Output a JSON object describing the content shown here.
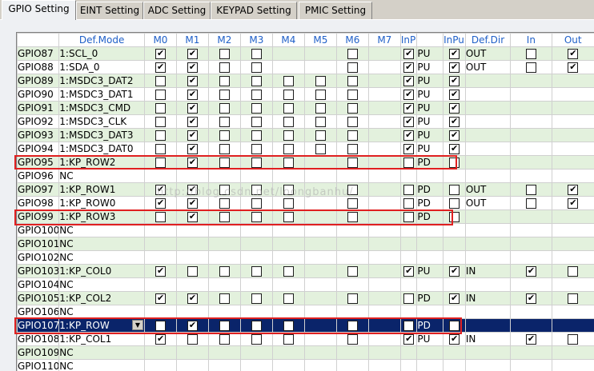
{
  "tabs": [
    {
      "label": "GPIO Setting",
      "active": true
    },
    {
      "label": "EINT Setting",
      "active": false
    },
    {
      "label": "ADC Setting",
      "active": false
    },
    {
      "label": "KEYPAD Setting",
      "active": false
    },
    {
      "label": "PMIC Setting",
      "active": false
    }
  ],
  "columns": [
    "",
    "Def.Mode",
    "M0",
    "M1",
    "M2",
    "M3",
    "M4",
    "M5",
    "M6",
    "M7",
    "InPu...",
    "",
    "InPu...",
    "Def.Dir",
    "In",
    "Out"
  ],
  "watermark": "http://blog.csdn.net/loongbanhu/",
  "rows": [
    {
      "gpio": "GPIO87",
      "mode": "1:SCL_0",
      "m": [
        1,
        1,
        0,
        0,
        null,
        null,
        0,
        null
      ],
      "pullSel": 1,
      "pull": "PU",
      "pullEn": 1,
      "dir": "OUT",
      "in": 0,
      "out": 1,
      "style": "even"
    },
    {
      "gpio": "GPIO88",
      "mode": "1:SDA_0",
      "m": [
        1,
        1,
        0,
        0,
        null,
        null,
        0,
        null
      ],
      "pullSel": 1,
      "pull": "PU",
      "pullEn": 1,
      "dir": "OUT",
      "in": 0,
      "out": 1,
      "style": "odd"
    },
    {
      "gpio": "GPIO89",
      "mode": "1:MSDC3_DAT2",
      "m": [
        0,
        1,
        0,
        0,
        0,
        0,
        0,
        null
      ],
      "pullSel": 1,
      "pull": "PU",
      "pullEn": 1,
      "dir": "",
      "in": null,
      "out": null,
      "style": "even"
    },
    {
      "gpio": "GPIO90",
      "mode": "1:MSDC3_DAT1",
      "m": [
        0,
        1,
        0,
        0,
        0,
        0,
        0,
        null
      ],
      "pullSel": 1,
      "pull": "PU",
      "pullEn": 1,
      "dir": "",
      "in": null,
      "out": null,
      "style": "odd"
    },
    {
      "gpio": "GPIO91",
      "mode": "1:MSDC3_CMD",
      "m": [
        0,
        1,
        0,
        0,
        0,
        0,
        0,
        null
      ],
      "pullSel": 1,
      "pull": "PU",
      "pullEn": 1,
      "dir": "",
      "in": null,
      "out": null,
      "style": "even"
    },
    {
      "gpio": "GPIO92",
      "mode": "1:MSDC3_CLK",
      "m": [
        0,
        1,
        0,
        0,
        0,
        0,
        0,
        null
      ],
      "pullSel": 1,
      "pull": "PU",
      "pullEn": 1,
      "dir": "",
      "in": null,
      "out": null,
      "style": "odd"
    },
    {
      "gpio": "GPIO93",
      "mode": "1:MSDC3_DAT3",
      "m": [
        0,
        1,
        0,
        0,
        0,
        0,
        0,
        null
      ],
      "pullSel": 1,
      "pull": "PU",
      "pullEn": 1,
      "dir": "",
      "in": null,
      "out": null,
      "style": "even"
    },
    {
      "gpio": "GPIO94",
      "mode": "1:MSDC3_DAT0",
      "m": [
        0,
        1,
        0,
        0,
        0,
        0,
        0,
        null
      ],
      "pullSel": 1,
      "pull": "PU",
      "pullEn": 1,
      "dir": "",
      "in": null,
      "out": null,
      "style": "odd"
    },
    {
      "gpio": "GPIO95",
      "mode": "1:KP_ROW2",
      "m": [
        0,
        1,
        0,
        0,
        0,
        null,
        0,
        null
      ],
      "pullSel": 0,
      "pull": "PD",
      "pullEn": 0,
      "dir": "",
      "in": null,
      "out": null,
      "style": "even"
    },
    {
      "gpio": "GPIO96",
      "mode": "NC",
      "m": [
        null,
        null,
        null,
        null,
        null,
        null,
        null,
        null
      ],
      "pullSel": null,
      "pull": "",
      "pullEn": null,
      "dir": "",
      "in": null,
      "out": null,
      "style": "odd"
    },
    {
      "gpio": "GPIO97",
      "mode": "1:KP_ROW1",
      "m": [
        1,
        1,
        0,
        0,
        0,
        null,
        0,
        null
      ],
      "pullSel": 0,
      "pull": "PD",
      "pullEn": 0,
      "dir": "OUT",
      "in": 0,
      "out": 1,
      "style": "even"
    },
    {
      "gpio": "GPIO98",
      "mode": "1:KP_ROW0",
      "m": [
        1,
        1,
        0,
        0,
        0,
        null,
        0,
        null
      ],
      "pullSel": 0,
      "pull": "PD",
      "pullEn": 0,
      "dir": "OUT",
      "in": 0,
      "out": 1,
      "style": "odd"
    },
    {
      "gpio": "GPIO99",
      "mode": "1:KP_ROW3",
      "m": [
        0,
        1,
        0,
        0,
        0,
        null,
        0,
        null
      ],
      "pullSel": 0,
      "pull": "PD",
      "pullEn": 0,
      "dir": "",
      "in": null,
      "out": null,
      "style": "even"
    },
    {
      "gpio": "GPIO100",
      "mode": "NC",
      "m": [
        null,
        null,
        null,
        null,
        null,
        null,
        null,
        null
      ],
      "pullSel": null,
      "pull": "",
      "pullEn": null,
      "dir": "",
      "in": null,
      "out": null,
      "style": "odd"
    },
    {
      "gpio": "GPIO101",
      "mode": "NC",
      "m": [
        null,
        null,
        null,
        null,
        null,
        null,
        null,
        null
      ],
      "pullSel": null,
      "pull": "",
      "pullEn": null,
      "dir": "",
      "in": null,
      "out": null,
      "style": "even"
    },
    {
      "gpio": "GPIO102",
      "mode": "NC",
      "m": [
        null,
        null,
        null,
        null,
        null,
        null,
        null,
        null
      ],
      "pullSel": null,
      "pull": "",
      "pullEn": null,
      "dir": "",
      "in": null,
      "out": null,
      "style": "odd"
    },
    {
      "gpio": "GPIO103",
      "mode": "1:KP_COL0",
      "m": [
        1,
        0,
        0,
        0,
        0,
        null,
        0,
        null
      ],
      "pullSel": 1,
      "pull": "PU",
      "pullEn": 1,
      "dir": "IN",
      "in": 1,
      "out": 0,
      "style": "even"
    },
    {
      "gpio": "GPIO104",
      "mode": "NC",
      "m": [
        null,
        null,
        null,
        null,
        null,
        null,
        null,
        null
      ],
      "pullSel": null,
      "pull": "",
      "pullEn": null,
      "dir": "",
      "in": null,
      "out": null,
      "style": "odd"
    },
    {
      "gpio": "GPIO105",
      "mode": "1:KP_COL2",
      "m": [
        1,
        1,
        0,
        0,
        0,
        null,
        0,
        null
      ],
      "pullSel": 0,
      "pull": "PD",
      "pullEn": 1,
      "dir": "IN",
      "in": 1,
      "out": 0,
      "style": "even"
    },
    {
      "gpio": "GPIO106",
      "mode": "NC",
      "m": [
        null,
        null,
        null,
        null,
        null,
        null,
        null,
        null
      ],
      "pullSel": null,
      "pull": "",
      "pullEn": null,
      "dir": "",
      "in": null,
      "out": null,
      "style": "odd"
    },
    {
      "gpio": "GPIO107",
      "mode": "1:KP_ROW",
      "m": [
        0,
        1,
        0,
        0,
        0,
        null,
        0,
        null
      ],
      "pullSel": 0,
      "pull": "PD",
      "pullEn": 0,
      "dir": "",
      "in": null,
      "out": null,
      "style": "sel"
    },
    {
      "gpio": "GPIO108",
      "mode": "1:KP_COL1",
      "m": [
        1,
        0,
        0,
        0,
        0,
        null,
        0,
        null
      ],
      "pullSel": 1,
      "pull": "PU",
      "pullEn": 1,
      "dir": "IN",
      "in": 1,
      "out": 0,
      "style": "odd"
    },
    {
      "gpio": "GPIO109",
      "mode": "NC",
      "m": [
        null,
        null,
        null,
        null,
        null,
        null,
        null,
        null
      ],
      "pullSel": null,
      "pull": "",
      "pullEn": null,
      "dir": "",
      "in": null,
      "out": null,
      "style": "even"
    },
    {
      "gpio": "GPIO110",
      "mode": "NC",
      "m": [
        null,
        null,
        null,
        null,
        null,
        null,
        null,
        null
      ],
      "pullSel": null,
      "pull": "",
      "pullEn": null,
      "dir": "",
      "in": null,
      "out": null,
      "style": "odd"
    }
  ]
}
